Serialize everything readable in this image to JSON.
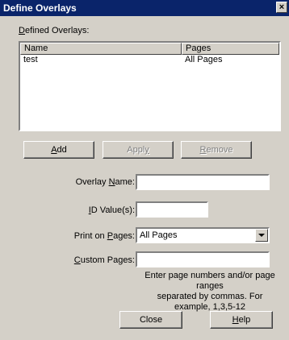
{
  "window": {
    "title": "Define Overlays",
    "close_glyph": "×"
  },
  "overlays_list": {
    "label": "Defined Overlays:",
    "columns": [
      "Name",
      "Pages"
    ],
    "rows": [
      {
        "name": "test",
        "pages": "All Pages"
      }
    ]
  },
  "buttons": {
    "add": "Add",
    "apply": "Apply",
    "remove": "Remove",
    "close": "Close",
    "help": "Help"
  },
  "form": {
    "overlay_name_label": "Overlay Name:",
    "overlay_name_value": "",
    "id_values_label": "ID Value(s):",
    "id_values_value": "",
    "print_on_pages_label": "Print on Pages:",
    "print_on_pages_value": "All Pages",
    "custom_pages_label": "Custom Pages:",
    "custom_pages_value": "",
    "hint_line1": "Enter page numbers and/or page ranges",
    "hint_line2": "separated by commas. For example, 1,3,5-12"
  }
}
